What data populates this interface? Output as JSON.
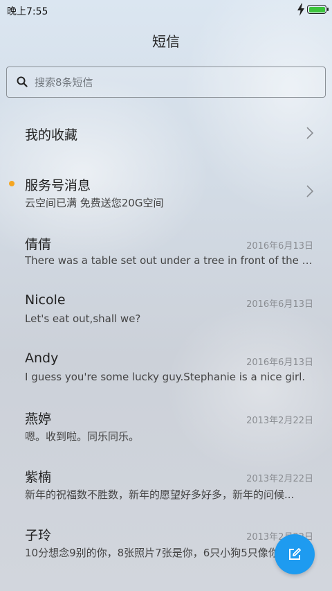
{
  "status_bar": {
    "time": "晚上7:55",
    "battery_level": 1.0,
    "charging": true,
    "battery_color": "#3cc43c"
  },
  "header": {
    "title": "短信"
  },
  "search": {
    "placeholder": "搜索8条短信",
    "value": ""
  },
  "favorites": {
    "label": "我的收藏"
  },
  "service": {
    "title": "服务号消息",
    "subtitle": "云空间已满 免费送您20G空间",
    "unread": true,
    "dot_color": "#f5a623"
  },
  "conversations": [
    {
      "name": "倩倩",
      "date": "2016年6月13日",
      "preview": "There was a table set out under a tree in front of the ho..."
    },
    {
      "name": "Nicole",
      "date": "2016年6月13日",
      "preview": "Let's eat out,shall we?"
    },
    {
      "name": "Andy",
      "date": "2016年6月13日",
      "preview": "I guess you're some lucky guy.Stephanie is a nice girl."
    },
    {
      "name": "燕婷",
      "date": "2013年2月22日",
      "preview": "嗯。收到啦。同乐同乐。"
    },
    {
      "name": "紫楠",
      "date": "2013年2月22日",
      "preview": "新年的祝福数不胜数，新年的愿望好多好多，新年的问候..."
    },
    {
      "name": "子玲",
      "date": "2013年2月22日",
      "preview": "10分想念9别的你，8张照片7张是你，6只小狗5只像你，..."
    }
  ],
  "fab": {
    "icon": "compose-icon",
    "color": "#1e9bf0"
  }
}
